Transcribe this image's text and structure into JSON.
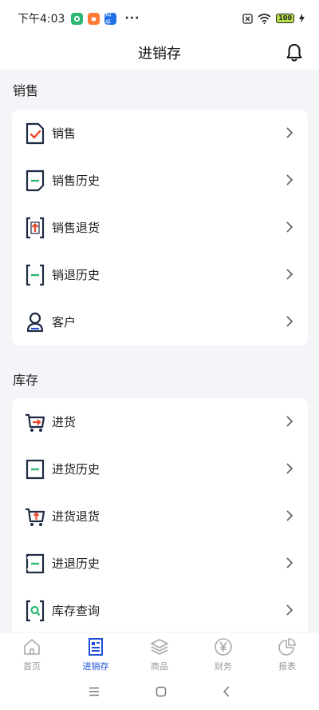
{
  "status": {
    "time": "下午4:03",
    "app_badge": "知乎",
    "battery": "100",
    "more": "···"
  },
  "header": {
    "title": "进销存"
  },
  "sections": [
    {
      "title": "销售",
      "items": [
        {
          "label": "销售",
          "icon": "sales-doc-icon"
        },
        {
          "label": "销售历史",
          "icon": "sales-history-icon"
        },
        {
          "label": "销售退货",
          "icon": "sales-return-icon"
        },
        {
          "label": "销退历史",
          "icon": "return-history-icon"
        },
        {
          "label": "客户",
          "icon": "customer-icon"
        }
      ]
    },
    {
      "title": "库存",
      "items": [
        {
          "label": "进货",
          "icon": "purchase-cart-icon"
        },
        {
          "label": "进货历史",
          "icon": "purchase-history-icon"
        },
        {
          "label": "进货退货",
          "icon": "purchase-return-icon"
        },
        {
          "label": "进退历史",
          "icon": "purchase-return-history-icon"
        },
        {
          "label": "库存查询",
          "icon": "stock-search-icon"
        }
      ]
    }
  ],
  "tabs": [
    {
      "label": "首页",
      "icon": "home-icon",
      "active": false
    },
    {
      "label": "进销存",
      "icon": "document-icon",
      "active": true
    },
    {
      "label": "商品",
      "icon": "layers-icon",
      "active": false
    },
    {
      "label": "财务",
      "icon": "yen-icon",
      "active": false
    },
    {
      "label": "报表",
      "icon": "pie-chart-icon",
      "active": false
    }
  ],
  "colors": {
    "accent": "#1e4fd6",
    "red": "#e8472c",
    "green": "#2bb673",
    "navy": "#1f2a44"
  }
}
